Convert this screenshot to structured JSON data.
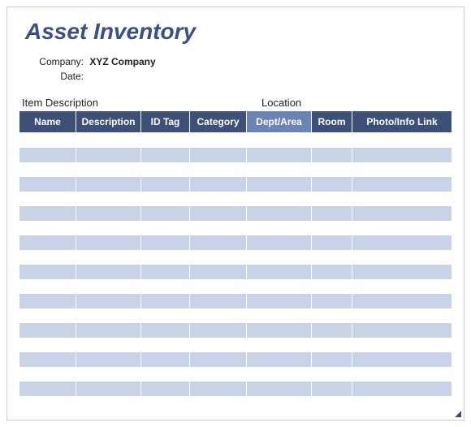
{
  "title": "Asset Inventory",
  "meta": {
    "company_label": "Company:",
    "company_value": "XYZ Company",
    "date_label": "Date:",
    "date_value": ""
  },
  "group_headers": {
    "item_description": "Item Description",
    "location": "Location"
  },
  "columns": {
    "name": "Name",
    "description": "Description",
    "id_tag": "ID Tag",
    "category": "Category",
    "dept_area": "Dept/Area",
    "room": "Room",
    "photo_info_link": "Photo/Info Link"
  },
  "chart_data": {
    "type": "table",
    "title": "Asset Inventory",
    "columns": [
      "Name",
      "Description",
      "ID Tag",
      "Category",
      "Dept/Area",
      "Room",
      "Photo/Info Link"
    ],
    "rows": [
      [
        "",
        "",
        "",
        "",
        "",
        "",
        ""
      ],
      [
        "",
        "",
        "",
        "",
        "",
        "",
        ""
      ],
      [
        "",
        "",
        "",
        "",
        "",
        "",
        ""
      ],
      [
        "",
        "",
        "",
        "",
        "",
        "",
        ""
      ],
      [
        "",
        "",
        "",
        "",
        "",
        "",
        ""
      ],
      [
        "",
        "",
        "",
        "",
        "",
        "",
        ""
      ],
      [
        "",
        "",
        "",
        "",
        "",
        "",
        ""
      ],
      [
        "",
        "",
        "",
        "",
        "",
        "",
        ""
      ],
      [
        "",
        "",
        "",
        "",
        "",
        "",
        ""
      ],
      [
        "",
        "",
        "",
        "",
        "",
        "",
        ""
      ],
      [
        "",
        "",
        "",
        "",
        "",
        "",
        ""
      ],
      [
        "",
        "",
        "",
        "",
        "",
        "",
        ""
      ],
      [
        "",
        "",
        "",
        "",
        "",
        "",
        ""
      ],
      [
        "",
        "",
        "",
        "",
        "",
        "",
        ""
      ],
      [
        "",
        "",
        "",
        "",
        "",
        "",
        ""
      ],
      [
        "",
        "",
        "",
        "",
        "",
        "",
        ""
      ],
      [
        "",
        "",
        "",
        "",
        "",
        "",
        ""
      ],
      [
        "",
        "",
        "",
        "",
        "",
        "",
        ""
      ],
      [
        "",
        "",
        "",
        "",
        "",
        "",
        ""
      ]
    ]
  }
}
